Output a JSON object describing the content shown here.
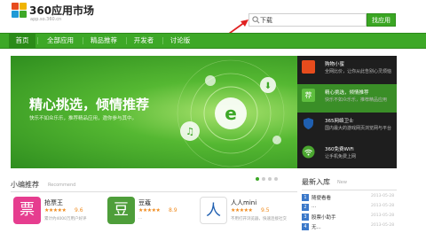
{
  "header": {
    "logo_title": "360应用市场",
    "logo_url": "app.so.360.cn"
  },
  "search": {
    "value": "下载",
    "button_label": "找应用"
  },
  "nav": {
    "items": [
      {
        "label": "首页"
      },
      {
        "label": "全部应用"
      },
      {
        "label": "精品推荐"
      },
      {
        "label": "开发者"
      },
      {
        "label": "讨论版"
      }
    ]
  },
  "banner": {
    "title": "精心挑选，倾情推荐",
    "subtitle": "快乐不如众乐乐，推荐精品应用，邀你参与其中。"
  },
  "side_list": [
    {
      "title": "购物小蜜",
      "desc": "全网比价，让你从此告别心灵烦恼",
      "icon": "shopping-bag-icon",
      "color": "#e74c1d"
    },
    {
      "title": "精心挑选，倾情推荐",
      "desc": "快乐不如众乐乐，推荐精品应用",
      "icon": "recommend-icon",
      "color": "#3da827"
    },
    {
      "title": "365网络卫士",
      "desc": "国内最大的游戏网页浏览网与平台",
      "icon": "shield-icon",
      "color": "#1f5fb0"
    },
    {
      "title": "360免费WiFi",
      "desc": "让手机免费上网",
      "icon": "wifi-icon",
      "color": "#4aa62f"
    }
  ],
  "section": {
    "title": "小编推荐",
    "en": "Recommend"
  },
  "apps": [
    {
      "name": "抢票王",
      "stars": "★★★★★",
      "score": "9.6",
      "desc": "累计约4000万用户好评",
      "icon_char": "票",
      "color": "#e63d8f"
    },
    {
      "name": "豆蔻",
      "stars": "★★★★★",
      "score": "8.9",
      "desc": "...",
      "icon_char": "豆",
      "color": "#4e9e3a"
    },
    {
      "name": "人人mini",
      "stars": "★★★★★",
      "score": "9.5",
      "desc": "不用打开浏览器，快速连接社交",
      "icon_char": "人",
      "color": "#ffffff"
    }
  ],
  "new_apps": {
    "title": "最新入库",
    "en": "New",
    "items": [
      {
        "num": "1",
        "name": "随便看看",
        "date": "2013-05-28"
      },
      {
        "num": "2",
        "name": "...",
        "date": "2013-05-28"
      },
      {
        "num": "3",
        "name": "股票小助手",
        "date": "2013-05-28"
      },
      {
        "num": "4",
        "name": "无...",
        "date": "2013-05-28"
      }
    ]
  },
  "colors": {
    "brand_green": "#3da827",
    "star_orange": "#f08a1c"
  }
}
